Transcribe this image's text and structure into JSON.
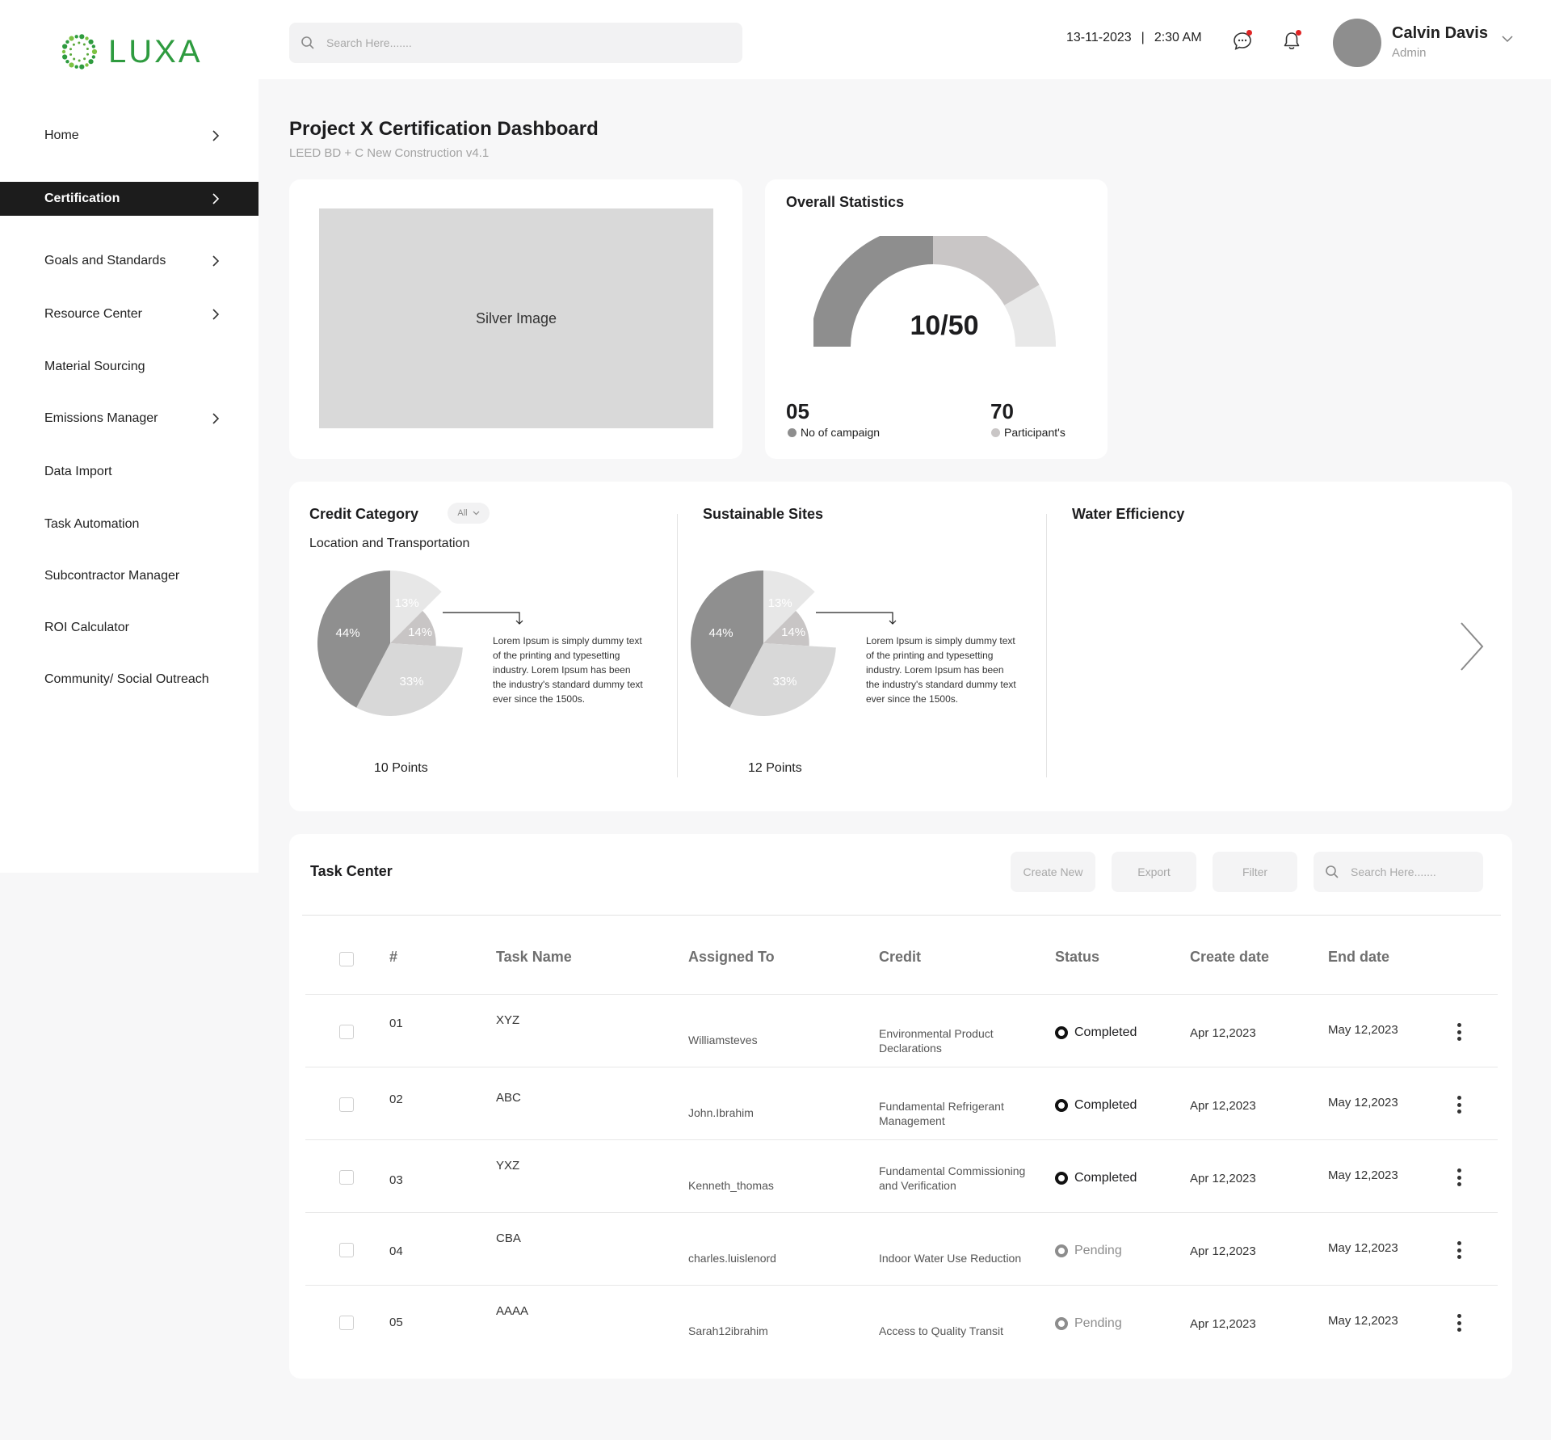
{
  "brand": {
    "name": "LUXA",
    "color": "#2e9b3f"
  },
  "header": {
    "search_placeholder": "Search Here.......",
    "date": "13-11-2023",
    "separator": "|",
    "time": "2:30 AM",
    "user_name": "Calvin Davis",
    "user_role": "Admin",
    "icons": [
      "search-icon",
      "chat-icon",
      "bell-icon",
      "chevron-down-icon"
    ],
    "notification_dot_color": "#e02424"
  },
  "sidebar": {
    "items": [
      {
        "label": "Home",
        "has_chevron": true,
        "active": false
      },
      {
        "label": "Certification",
        "has_chevron": true,
        "active": true
      },
      {
        "label": "Goals and Standards",
        "has_chevron": true,
        "active": false
      },
      {
        "label": "Resource Center",
        "has_chevron": true,
        "active": false
      },
      {
        "label": "Material Sourcing",
        "has_chevron": false,
        "active": false
      },
      {
        "label": "Emissions Manager",
        "has_chevron": true,
        "active": false
      },
      {
        "label": "Data Import",
        "has_chevron": false,
        "active": false
      },
      {
        "label": "Task Automation",
        "has_chevron": false,
        "active": false
      },
      {
        "label": "Subcontractor Manager",
        "has_chevron": false,
        "active": false
      },
      {
        "label": "ROI Calculator",
        "has_chevron": false,
        "active": false
      },
      {
        "label": "Community/ Social Outreach",
        "has_chevron": false,
        "active": false
      }
    ]
  },
  "page": {
    "title": "Project X Certification Dashboard",
    "subtitle": "LEED BD + C New Construction v4.1"
  },
  "silver_card": {
    "image_label": "Silver Image"
  },
  "overall_stats": {
    "title": "Overall Statistics",
    "gauge_value": "10/50",
    "campaign_count": "05",
    "campaign_label": "No of campaign",
    "participant_count": "70",
    "participant_label": "Participant's",
    "campaign_color": "#8e8e8e",
    "participant_color": "#c9c6c6"
  },
  "credit_category": {
    "title": "Credit Category",
    "filter_value": "All",
    "sub_label": "Location and Transportation",
    "points": "10 Points",
    "description": "Lorem Ipsum is simply dummy text of the printing and typesetting industry. Lorem Ipsum has been the industry's standard dummy text ever since the 1500s."
  },
  "sustainable_sites": {
    "title": "Sustainable Sites",
    "points": "12 Points",
    "description": "Lorem Ipsum is simply dummy text of the printing and typesetting industry. Lorem Ipsum has been the industry's standard dummy text ever since the 1500s."
  },
  "water_efficiency": {
    "title": "Water Efficiency"
  },
  "chart_data": [
    {
      "type": "pie",
      "categories": [
        "44%",
        "13%",
        "14%",
        "33%"
      ],
      "values": [
        44,
        13,
        14,
        33
      ],
      "colors": [
        "#8f8f8f",
        "#e7e7e7",
        "#c8c5c5",
        "#d8d8d8"
      ]
    },
    {
      "type": "pie",
      "categories": [
        "44%",
        "13%",
        "14%",
        "33%"
      ],
      "values": [
        44,
        13,
        14,
        33
      ],
      "colors": [
        "#8f8f8f",
        "#e7e7e7",
        "#c8c5c5",
        "#d8d8d8"
      ]
    }
  ],
  "task_center": {
    "title": "Task Center",
    "buttons": {
      "create": "Create New",
      "export": "Export",
      "filter": "Filter"
    },
    "search_placeholder": "Search Here.......",
    "columns": [
      "#",
      "Task Name",
      "Assigned To",
      "Credit",
      "Status",
      "Create date",
      "End date"
    ],
    "rows": [
      {
        "num": "01",
        "task": "XYZ",
        "assigned": "Williamsteves",
        "credit": "Environmental Product Declarations",
        "status": "Completed",
        "create": "Apr 12,2023",
        "end": "May 12,2023"
      },
      {
        "num": "02",
        "task": "ABC",
        "assigned": "John.Ibrahim",
        "credit": "Fundamental Refrigerant Management",
        "status": "Completed",
        "create": "Apr 12,2023",
        "end": "May 12,2023"
      },
      {
        "num": "03",
        "task": "YXZ",
        "assigned": "Kenneth_thomas",
        "credit": "Fundamental Commissioning and Verification",
        "status": "Completed",
        "create": "Apr 12,2023",
        "end": "May 12,2023"
      },
      {
        "num": "04",
        "task": "CBA",
        "assigned": "charles.luislenord",
        "credit": "Indoor Water Use Reduction",
        "status": "Pending",
        "create": "Apr 12,2023",
        "end": "May 12,2023"
      },
      {
        "num": "05",
        "task": "AAAA",
        "assigned": "Sarah12ibrahim",
        "credit": "Access to Quality Transit",
        "status": "Pending",
        "create": "Apr 12,2023",
        "end": "May 12,2023"
      }
    ]
  }
}
